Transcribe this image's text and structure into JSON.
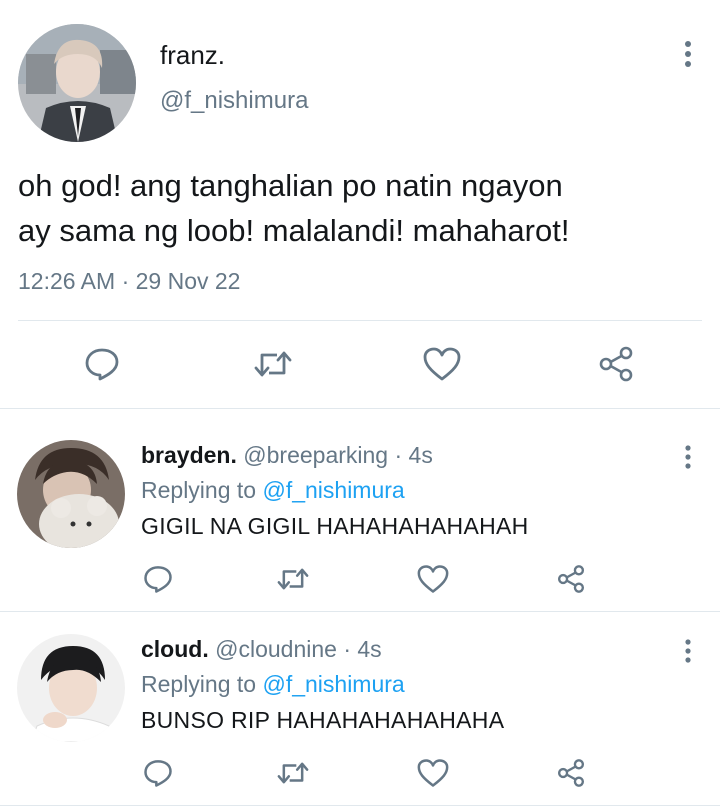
{
  "main_tweet": {
    "name": "franz.",
    "handle": "@f_nishimura",
    "text_line1": "oh god! ang tanghalian po natin ngayon",
    "text_line2": "ay sama ng loob! malalandi! mahaharot!",
    "timestamp": "12:26 AM · 29 Nov 22",
    "actions": [
      "reply-icon",
      "retweet-icon",
      "like-icon",
      "share-icon"
    ]
  },
  "replies": [
    {
      "name": "brayden.",
      "meta": "@breeparking · 4s",
      "replying_prefix": "Replying to",
      "replying_handle": "@f_nishimura",
      "text": "GIGIL NA GIGIL HAHAHAHAHAHAH"
    },
    {
      "name": "cloud.",
      "meta": "@cloudnine · 4s",
      "replying_prefix": "Replying to",
      "replying_handle": "@f_nishimura",
      "text": "BUNSO RIP HAHAHAHAHAHAHA"
    }
  ],
  "colors": {
    "text": "#14171a",
    "secondary": "#657786",
    "link": "#1da1f2",
    "divider": "#e1e8ed",
    "icon": "#657786"
  }
}
